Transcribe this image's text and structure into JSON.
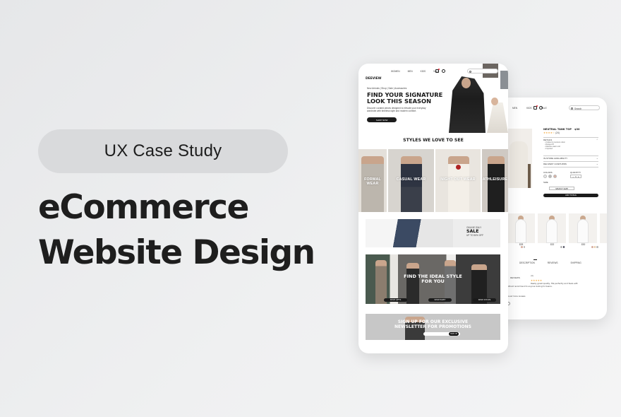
{
  "hero": {
    "pill_label": "UX Case Study",
    "title_line1": "eCommerce",
    "title_line2": "Website Design"
  },
  "front_phone": {
    "logo": "DEEVIEW",
    "nav": [
      "WOMEN",
      "MEN",
      "KIDS",
      "SALE"
    ],
    "tagline": "New Arrivals | Shop | Sale | Accessories",
    "headline_line1": "FIND YOUR SIGNATURE",
    "headline_line2": "LOOK THIS SEASON",
    "paragraph": "Discover curated pieces designed to elevate your everyday wardrobe with timeless style and modern comfort.",
    "shop_button": "SHOP NOW",
    "styles_heading": "STYLES WE LOVE TO SEE",
    "tiles": [
      {
        "label": "FORMAL WEAR",
        "bg": "#e4e0da"
      },
      {
        "label": "CASUAL WEAR",
        "bg": "#d7d4cf"
      },
      {
        "label": "NIGHT OUT WEAR",
        "bg": "#e9e5df"
      },
      {
        "label": "ATHLEISURE",
        "bg": "#cfc9c3"
      }
    ],
    "sale_banner": {
      "small": "ONLINE ONLY",
      "big": "SALE",
      "sub": "UP TO 50% OFF"
    },
    "ideal_banner": {
      "title_line1": "FIND THE IDEAL STYLE",
      "title_line2": "FOR YOU",
      "buttons": [
        "SHOP GIFTS",
        "SHOP PARTY",
        "SHOP STYLES"
      ]
    },
    "news_banner": {
      "title_line1": "SIGN UP FOR OUR EXCLUSIVE",
      "title_line2": "NEWSLETTER FOR PROMOTIONS",
      "button": "SIGN UP"
    }
  },
  "back_phone": {
    "nav": [
      "MEN",
      "KIDS",
      "SALE"
    ],
    "search_placeholder": "Search",
    "product_name": "NEUTRAL TANK TOP",
    "price": "$30",
    "rating": "★★★★☆",
    "reviews": "(24)",
    "accordion": [
      "DETAILS",
      "IN-STORE AVAILABILITY",
      "DELIVERY & RETURNS"
    ],
    "details_lines": [
      "• Crafted in premium cotton",
      "• Relaxed fit",
      "• Machine wash cold",
      "• Imported"
    ],
    "colors_label": "COLORS",
    "quantity_label": "QUANTITY",
    "quantity": "1",
    "size_label": "SIZE",
    "size_value": "SELECT SIZE",
    "add_button": "ADD TO BAG",
    "swatches": [
      "#e7e7e7",
      "#b9b9b9",
      "#d9b2a4"
    ],
    "related": [
      {
        "price": "$28"
      },
      {
        "price": "$32"
      },
      {
        "price": "$30"
      },
      {
        "price": "$34"
      }
    ],
    "tabs": [
      "DESCRIPTION",
      "REVIEWS",
      "SHIPPING"
    ],
    "review_heading": "REVIEWS",
    "review_stars": "★★★★★",
    "review_count": "(4)",
    "review_text": "Really great quality, fits perfectly and feels soft.",
    "review_text2": "Would recommend to anyone looking for basics.",
    "footer_text": "Load more reviews"
  }
}
